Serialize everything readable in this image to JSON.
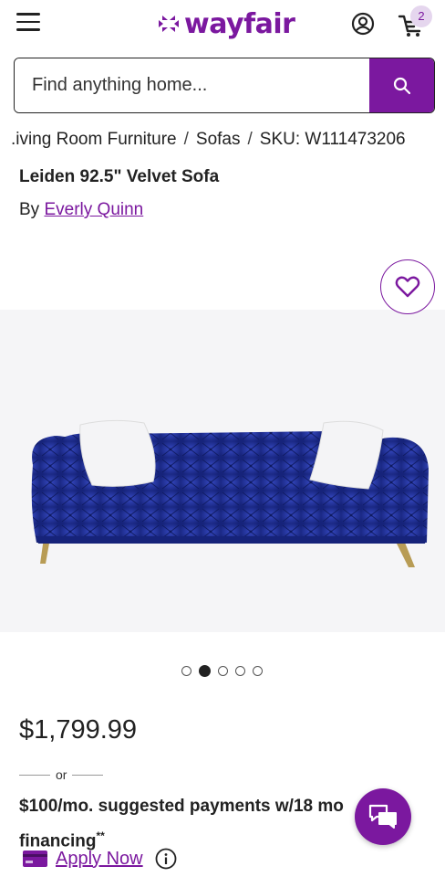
{
  "header": {
    "logo_text": "wayfair",
    "cart_count": "2",
    "icons": [
      "hamburger-menu-icon",
      "wayfair-logo-mark",
      "account-icon",
      "cart-icon"
    ]
  },
  "search": {
    "placeholder": "Find anything home...",
    "button_icon": "search-icon"
  },
  "breadcrumb": {
    "items": [
      "Living Room Furniture",
      "Sofas"
    ],
    "visible_first": ".iving Room Furniture",
    "sku": "SKU: W111473206",
    "separator": "/"
  },
  "product": {
    "title": "Leiden 92.5\" Velvet Sofa",
    "by_prefix": "By",
    "brand": "Everly Quinn",
    "favorite_icon": "heart-icon",
    "image_count": 5,
    "active_image": 2
  },
  "pricing": {
    "price": "$1,799.99",
    "or_text": "or",
    "financing_line1": "$100/mo. suggested payments w/18 mo",
    "financing_line2": "financing",
    "financing_sup": "**",
    "apply_label": "Apply Now"
  },
  "colors": {
    "brand_purple": "#7b189f",
    "sofa_blue": "#1d2f9a",
    "image_bg": "#f5f5f7"
  }
}
